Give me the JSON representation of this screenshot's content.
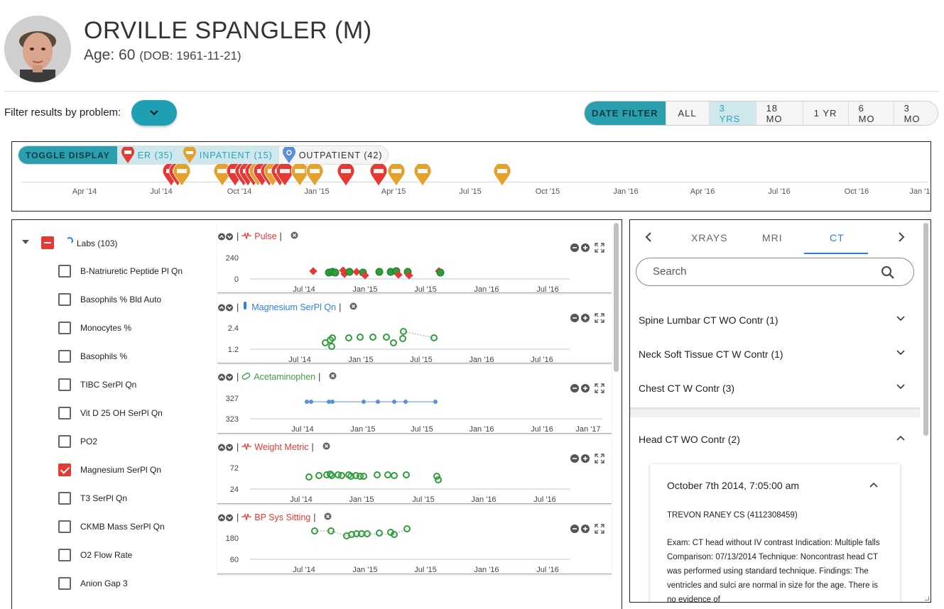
{
  "patient": {
    "name": "ORVILLE SPANGLER (M)",
    "age": "Age: 60",
    "dob": "(DOB: 1961-11-21)"
  },
  "filter": {
    "label": "Filter results by problem:",
    "date_filter_label": "DATE FILTER",
    "date_options": [
      "ALL",
      "3 YRS",
      "18 MO",
      "1 YR",
      "6 MO",
      "3 MO"
    ],
    "active_option": "3 YRS"
  },
  "timeline": {
    "toggle_label": "TOGGLE DISPLAY",
    "er": "ER (35)",
    "inpatient": "INPATIENT (15)",
    "outpatient": "OUTPATIENT (42)",
    "ticks": [
      "Apr '14",
      "Jul '14",
      "Oct '14",
      "Jan '15",
      "Apr '15",
      "Jul '15",
      "Oct '15",
      "Jan '16",
      "Apr '16",
      "Jul '16",
      "Oct '16",
      "Jan '1"
    ],
    "colors": {
      "er": "#e53935",
      "inpatient": "#e5a12e",
      "outpatient": "#5b8fd8"
    }
  },
  "labs": {
    "group_label": "Labs (103)",
    "items": [
      {
        "label": "B-Natriuretic Peptide Pl Qn",
        "checked": false
      },
      {
        "label": "Basophils % Bld Auto",
        "checked": false
      },
      {
        "label": "Monocytes %",
        "checked": false
      },
      {
        "label": "Basophils %",
        "checked": false
      },
      {
        "label": "TIBC SerPl Qn",
        "checked": false
      },
      {
        "label": "Vit D 25 OH SerPl Qn",
        "checked": false
      },
      {
        "label": "PO2",
        "checked": false
      },
      {
        "label": "Magnesium SerPl Qn",
        "checked": true
      },
      {
        "label": "T3 SerPl Qn",
        "checked": false
      },
      {
        "label": "CKMB Mass SerPl Qn",
        "checked": false
      },
      {
        "label": "O2 Flow Rate",
        "checked": false
      },
      {
        "label": "Anion Gap 3",
        "checked": false
      }
    ]
  },
  "charts": [
    {
      "title": "Pulse",
      "color": "#e53935",
      "icon": "pulse-icon",
      "yticks": [
        "240",
        "0"
      ],
      "xticks": [
        "Jul '14",
        "Jan '15",
        "Jul '15",
        "Jan '16",
        "Jul '16"
      ]
    },
    {
      "title": "Magnesium SerPl Qn",
      "color": "#2f7fe0",
      "icon": "test-tube-icon",
      "yticks": [
        "2.4",
        "1.2"
      ],
      "xticks": [
        "Jul '14",
        "Jan '15",
        "Jul '15",
        "Jan '16",
        "Jul '16"
      ]
    },
    {
      "title": "Acetaminophen",
      "color": "#43a047",
      "icon": "pill-icon",
      "yticks": [
        "327",
        "323"
      ],
      "xticks": [
        "Jul '14",
        "Jan '15",
        "Jul '15",
        "Jan '16",
        "Jul '16",
        "Jan '17"
      ]
    },
    {
      "title": "Weight Metric",
      "color": "#e53935",
      "icon": "pulse-icon",
      "yticks": [
        "72",
        "24"
      ],
      "xticks": [
        "Jul '14",
        "Jan '15",
        "Jul '15",
        "Jan '16",
        "Jul '16"
      ]
    },
    {
      "title": "BP Sys Sitting",
      "color": "#e53935",
      "icon": "pulse-icon",
      "yticks": [
        "180",
        "60"
      ],
      "xticks": [
        "Jul '14",
        "Jan '15",
        "Jul '15",
        "Jan '16",
        "Jul '16"
      ]
    }
  ],
  "imaging": {
    "tabs": [
      "XRAYS",
      "MRI",
      "CT"
    ],
    "active_tab": "CT",
    "search_placeholder": "Search",
    "sections": [
      {
        "label": "Spine Lumbar CT WO Contr (1)",
        "expanded": false
      },
      {
        "label": "Neck Soft Tissue CT W Contr (1)",
        "expanded": false
      },
      {
        "label": "Chest CT W Contr (3)",
        "expanded": false
      },
      {
        "label": "Head CT WO Contr (2)",
        "expanded": true
      }
    ],
    "report": {
      "date": "October 7th 2014, 7:05:00 am",
      "author": "TREVON RANEY CS (4112308459)",
      "body": "Exam: CT head without IV contrast Indication: Multiple falls Comparison: 07/13/2014 Technique: Noncontrast head CT was performed using standard technique. Findings: The ventricles and sulci are normal in size for the age. There is no evidence of"
    }
  }
}
